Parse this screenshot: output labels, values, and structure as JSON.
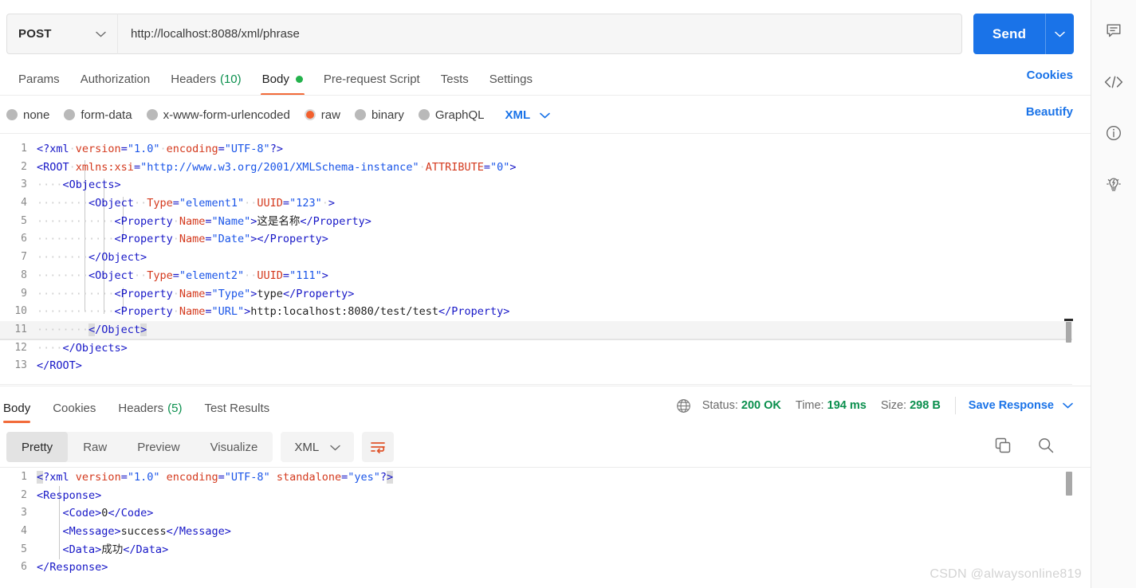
{
  "request": {
    "method": "POST",
    "url": "http://localhost:8088/xml/phrase",
    "send_label": "Send",
    "tabs": [
      {
        "label": "Params",
        "count": "",
        "active": false,
        "dot": false
      },
      {
        "label": "Authorization",
        "count": "",
        "active": false,
        "dot": false
      },
      {
        "label": "Headers",
        "count": "(10)",
        "active": false,
        "dot": false
      },
      {
        "label": "Body",
        "count": "",
        "active": true,
        "dot": true
      },
      {
        "label": "Pre-request Script",
        "count": "",
        "active": false,
        "dot": false
      },
      {
        "label": "Tests",
        "count": "",
        "active": false,
        "dot": false
      },
      {
        "label": "Settings",
        "count": "",
        "active": false,
        "dot": false
      }
    ],
    "cookies_link": "Cookies",
    "beautify_link": "Beautify",
    "body_types": [
      {
        "label": "none",
        "selected": false
      },
      {
        "label": "form-data",
        "selected": false
      },
      {
        "label": "x-www-form-urlencoded",
        "selected": false
      },
      {
        "label": "raw",
        "selected": true
      },
      {
        "label": "binary",
        "selected": false
      },
      {
        "label": "GraphQL",
        "selected": false
      }
    ],
    "format": "XML"
  },
  "request_body": {
    "language": "xml",
    "active_line": 11,
    "raw": "<?xml version=\"1.0\" encoding=\"UTF-8\"?>\n<ROOT xmlns:xsi=\"http://www.w3.org/2001/XMLSchema-instance\" ATTRIBUTE=\"0\">\n    <Objects>\n        <Object  Type=\"element1\"  UUID=\"123\" >\n            <Property Name=\"Name\">这是名称</Property>\n            <Property Name=\"Date\"></Property>\n        </Object>\n        <Object  Type=\"element2\"  UUID=\"111\">\n            <Property Name=\"Type\">type</Property>\n            <Property Name=\"URL\">http:localhost:8080/test/test</Property>\n        </Object>\n    </Objects>\n</ROOT>",
    "lines": [
      {
        "n": "1",
        "tokens": [
          {
            "t": "tag",
            "v": "<?xml"
          },
          {
            "t": "ws",
            "v": "·"
          },
          {
            "t": "attr",
            "v": "version"
          },
          {
            "t": "tag",
            "v": "="
          },
          {
            "t": "str",
            "v": "\"1.0\""
          },
          {
            "t": "ws",
            "v": "·"
          },
          {
            "t": "attr",
            "v": "encoding"
          },
          {
            "t": "tag",
            "v": "="
          },
          {
            "t": "str",
            "v": "\"UTF-8\""
          },
          {
            "t": "tag",
            "v": "?>"
          }
        ]
      },
      {
        "n": "2",
        "tokens": [
          {
            "t": "tag",
            "v": "<ROOT"
          },
          {
            "t": "ws",
            "v": "·"
          },
          {
            "t": "attr",
            "v": "xmlns:xsi"
          },
          {
            "t": "tag",
            "v": "="
          },
          {
            "t": "str",
            "v": "\"http://www.w3.org/2001/XMLSchema-instance\""
          },
          {
            "t": "ws",
            "v": "·"
          },
          {
            "t": "attr",
            "v": "ATTRIBUTE"
          },
          {
            "t": "tag",
            "v": "="
          },
          {
            "t": "str",
            "v": "\"0\""
          },
          {
            "t": "tag",
            "v": ">"
          }
        ]
      },
      {
        "n": "3",
        "tokens": [
          {
            "t": "ws",
            "v": "····"
          },
          {
            "t": "tag",
            "v": "<Objects>"
          }
        ]
      },
      {
        "n": "4",
        "tokens": [
          {
            "t": "ws",
            "v": "········"
          },
          {
            "t": "tag",
            "v": "<Object"
          },
          {
            "t": "ws",
            "v": "··"
          },
          {
            "t": "attr",
            "v": "Type"
          },
          {
            "t": "tag",
            "v": "="
          },
          {
            "t": "str",
            "v": "\"element1\""
          },
          {
            "t": "ws",
            "v": "··"
          },
          {
            "t": "attr",
            "v": "UUID"
          },
          {
            "t": "tag",
            "v": "="
          },
          {
            "t": "str",
            "v": "\"123\""
          },
          {
            "t": "ws",
            "v": "·"
          },
          {
            "t": "tag",
            "v": ">"
          }
        ]
      },
      {
        "n": "5",
        "tokens": [
          {
            "t": "ws",
            "v": "············"
          },
          {
            "t": "tag",
            "v": "<Property"
          },
          {
            "t": "ws",
            "v": "·"
          },
          {
            "t": "attr",
            "v": "Name"
          },
          {
            "t": "tag",
            "v": "="
          },
          {
            "t": "str",
            "v": "\"Name\""
          },
          {
            "t": "tag",
            "v": ">"
          },
          {
            "t": "txt",
            "v": "这是名称"
          },
          {
            "t": "tag",
            "v": "</Property>"
          }
        ]
      },
      {
        "n": "6",
        "tokens": [
          {
            "t": "ws",
            "v": "············"
          },
          {
            "t": "tag",
            "v": "<Property"
          },
          {
            "t": "ws",
            "v": "·"
          },
          {
            "t": "attr",
            "v": "Name"
          },
          {
            "t": "tag",
            "v": "="
          },
          {
            "t": "str",
            "v": "\"Date\""
          },
          {
            "t": "tag",
            "v": ">"
          },
          {
            "t": "tag",
            "v": "</Property>"
          }
        ]
      },
      {
        "n": "7",
        "tokens": [
          {
            "t": "ws",
            "v": "········"
          },
          {
            "t": "tag",
            "v": "</Object>"
          }
        ]
      },
      {
        "n": "8",
        "tokens": [
          {
            "t": "ws",
            "v": "········"
          },
          {
            "t": "tag",
            "v": "<Object"
          },
          {
            "t": "ws",
            "v": "··"
          },
          {
            "t": "attr",
            "v": "Type"
          },
          {
            "t": "tag",
            "v": "="
          },
          {
            "t": "str",
            "v": "\"element2\""
          },
          {
            "t": "ws",
            "v": "··"
          },
          {
            "t": "attr",
            "v": "UUID"
          },
          {
            "t": "tag",
            "v": "="
          },
          {
            "t": "str",
            "v": "\"111\""
          },
          {
            "t": "tag",
            "v": ">"
          }
        ]
      },
      {
        "n": "9",
        "tokens": [
          {
            "t": "ws",
            "v": "············"
          },
          {
            "t": "tag",
            "v": "<Property"
          },
          {
            "t": "ws",
            "v": "·"
          },
          {
            "t": "attr",
            "v": "Name"
          },
          {
            "t": "tag",
            "v": "="
          },
          {
            "t": "str",
            "v": "\"Type\""
          },
          {
            "t": "tag",
            "v": ">"
          },
          {
            "t": "txt",
            "v": "type"
          },
          {
            "t": "tag",
            "v": "</Property>"
          }
        ]
      },
      {
        "n": "10",
        "tokens": [
          {
            "t": "ws",
            "v": "············"
          },
          {
            "t": "tag",
            "v": "<Property"
          },
          {
            "t": "ws",
            "v": "·"
          },
          {
            "t": "attr",
            "v": "Name"
          },
          {
            "t": "tag",
            "v": "="
          },
          {
            "t": "str",
            "v": "\"URL\""
          },
          {
            "t": "tag",
            "v": ">"
          },
          {
            "t": "txt",
            "v": "http:localhost:8080/test/test"
          },
          {
            "t": "tag",
            "v": "</Property>"
          }
        ]
      },
      {
        "n": "11",
        "tokens": [
          {
            "t": "ws",
            "v": "········"
          },
          {
            "t": "cur",
            "v": "<"
          },
          {
            "t": "tag",
            "v": "/Object"
          },
          {
            "t": "cur",
            "v": ">"
          }
        ]
      },
      {
        "n": "12",
        "tokens": [
          {
            "t": "ws",
            "v": "····"
          },
          {
            "t": "tag",
            "v": "</Objects>"
          }
        ]
      },
      {
        "n": "13",
        "tokens": [
          {
            "t": "tag",
            "v": "</ROOT>"
          }
        ]
      }
    ]
  },
  "response": {
    "tabs": [
      {
        "label": "Body",
        "count": "",
        "active": true
      },
      {
        "label": "Cookies",
        "count": "",
        "active": false
      },
      {
        "label": "Headers",
        "count": "(5)",
        "active": false
      },
      {
        "label": "Test Results",
        "count": "",
        "active": false
      }
    ],
    "status_label": "Status:",
    "status_value": "200 OK",
    "time_label": "Time:",
    "time_value": "194 ms",
    "size_label": "Size:",
    "size_value": "298 B",
    "save_label": "Save Response",
    "view_modes": [
      {
        "label": "Pretty",
        "active": true
      },
      {
        "label": "Raw",
        "active": false
      },
      {
        "label": "Preview",
        "active": false
      },
      {
        "label": "Visualize",
        "active": false
      }
    ],
    "format": "XML"
  },
  "response_body": {
    "language": "xml",
    "raw": "<?xml version=\"1.0\" encoding=\"UTF-8\" standalone=\"yes\"?>\n<Response>\n    <Code>0</Code>\n    <Message>success</Message>\n    <Data>成功</Data>\n</Response>",
    "lines": [
      {
        "n": "1",
        "tokens": [
          {
            "t": "cur",
            "v": "<"
          },
          {
            "t": "tag",
            "v": "?xml"
          },
          {
            "t": "ws2",
            "v": " "
          },
          {
            "t": "attr",
            "v": "version"
          },
          {
            "t": "tag",
            "v": "="
          },
          {
            "t": "str",
            "v": "\"1.0\""
          },
          {
            "t": "ws2",
            "v": " "
          },
          {
            "t": "attr",
            "v": "encoding"
          },
          {
            "t": "tag",
            "v": "="
          },
          {
            "t": "str",
            "v": "\"UTF-8\""
          },
          {
            "t": "ws2",
            "v": " "
          },
          {
            "t": "attr",
            "v": "standalone"
          },
          {
            "t": "tag",
            "v": "="
          },
          {
            "t": "str",
            "v": "\"yes\""
          },
          {
            "t": "tag",
            "v": "?"
          },
          {
            "t": "cur",
            "v": ">"
          }
        ]
      },
      {
        "n": "2",
        "tokens": [
          {
            "t": "tag",
            "v": "<Response>"
          }
        ]
      },
      {
        "n": "3",
        "tokens": [
          {
            "t": "ws2",
            "v": "    "
          },
          {
            "t": "tag",
            "v": "<Code>"
          },
          {
            "t": "txt",
            "v": "0"
          },
          {
            "t": "tag",
            "v": "</Code>"
          }
        ]
      },
      {
        "n": "4",
        "tokens": [
          {
            "t": "ws2",
            "v": "    "
          },
          {
            "t": "tag",
            "v": "<Message>"
          },
          {
            "t": "txt",
            "v": "success"
          },
          {
            "t": "tag",
            "v": "</Message>"
          }
        ]
      },
      {
        "n": "5",
        "tokens": [
          {
            "t": "ws2",
            "v": "    "
          },
          {
            "t": "tag",
            "v": "<Data>"
          },
          {
            "t": "txt",
            "v": "成功"
          },
          {
            "t": "tag",
            "v": "</Data>"
          }
        ]
      },
      {
        "n": "6",
        "tokens": [
          {
            "t": "tag",
            "v": "</Response>"
          }
        ]
      }
    ]
  },
  "sidebar_icons": [
    {
      "name": "comment-icon"
    },
    {
      "name": "code-icon"
    },
    {
      "name": "info-icon"
    },
    {
      "name": "lightbulb-icon"
    }
  ],
  "watermark": "CSDN @alwaysonline819",
  "colors": {
    "accent_blue": "#1a73e8",
    "accent_orange": "#f26b3a",
    "status_green": "#0a8f4d",
    "radio_selected": "#f2602e"
  }
}
